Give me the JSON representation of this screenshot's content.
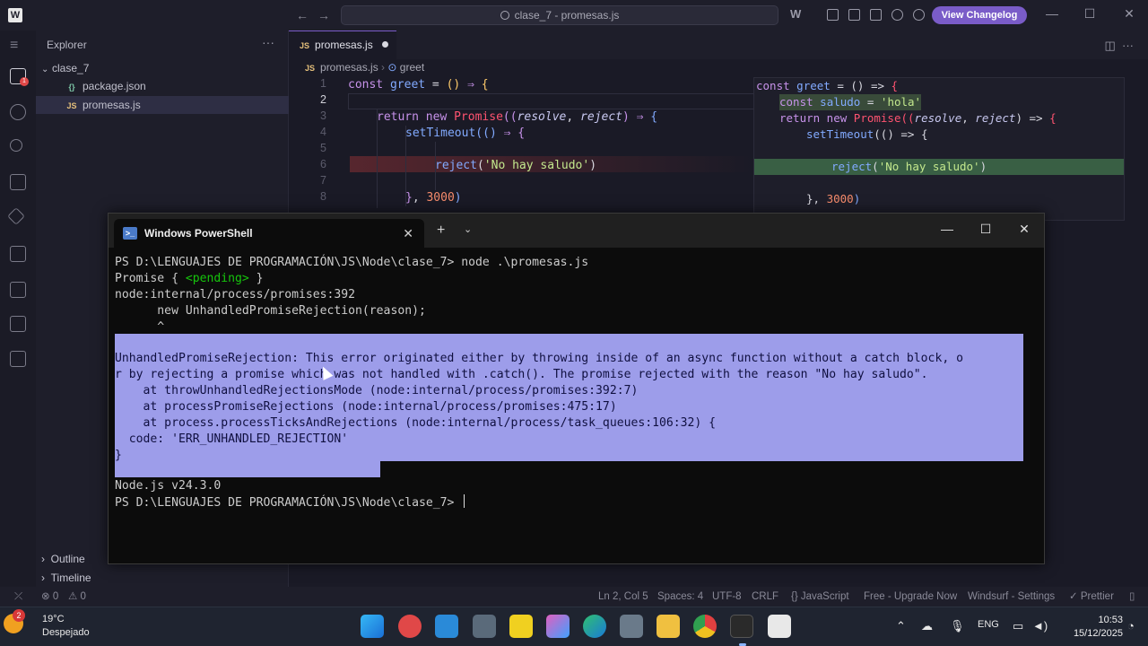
{
  "titlebar": {
    "search_text": "clase_7 - promesas.js",
    "changelog_label": "View Changelog",
    "minimize": "—",
    "maximize": "☐",
    "close": "✕",
    "back": "←",
    "forward": "→"
  },
  "sidebar": {
    "title": "Explorer",
    "more": "···",
    "folder": "clase_7",
    "files": [
      {
        "name": "package.json",
        "icon": "{}"
      },
      {
        "name": "promesas.js",
        "icon": "JS"
      }
    ],
    "outline": "Outline",
    "timeline": "Timeline",
    "badge": "1"
  },
  "editor": {
    "tab_label": "promesas.js",
    "tab_icon": "JS",
    "breadcrumb": [
      "promesas.js",
      "greet"
    ],
    "line_numbers": [
      "1",
      "2",
      "3",
      "4",
      "5",
      "6",
      "7",
      "8"
    ],
    "code": {
      "l1": [
        "const",
        " ",
        "greet",
        " = ",
        "()",
        " ⇒ ",
        "{"
      ],
      "l3": [
        "return",
        " ",
        "new",
        " ",
        "Promise",
        "((",
        "resolve",
        ", ",
        "reject",
        ")",
        " ⇒ ",
        "{"
      ],
      "l4": [
        "setTimeout",
        "((",
        ")",
        " ⇒ ",
        "{"
      ],
      "l6": [
        "reject",
        "(",
        "'No hay saludo'",
        ")"
      ],
      "l8": [
        "}",
        ", ",
        "3000",
        ")"
      ]
    }
  },
  "peek": {
    "l1": [
      "const",
      " greet ",
      "= () => ",
      "{"
    ],
    "l2": [
      "const",
      " saludo ",
      "= ",
      "'hola'"
    ],
    "l3": [
      "return",
      " new ",
      "Promise",
      "((",
      "resolve",
      ", ",
      "reject",
      ") => ",
      "{"
    ],
    "l4": [
      "setTimeout",
      "(() => {"
    ],
    "l6": [
      "reject",
      "(",
      "'No hay saludo'",
      ")"
    ],
    "l8": [
      "}, ",
      "3000",
      ")"
    ]
  },
  "powershell": {
    "tab_title": "Windows PowerShell",
    "tab_close": "✕",
    "new_tab": "+",
    "dropdown": "⌄",
    "minimize": "—",
    "maximize": "☐",
    "close": "✕",
    "lines": [
      "PS D:\\LENGUAJES DE PROGRAMACIÓN\\JS\\Node\\clase_7> node .\\promesas.js",
      "Promise { ",
      "<pending>",
      " }",
      "node:internal/process/promises:392",
      "      new UnhandledPromiseRejection(reason);",
      "      ^",
      "",
      "UnhandledPromiseRejection: This error originated either by throwing inside of an async function without a catch block, o",
      "r by rejecting a promise which was not handled with .catch(). The promise rejected with the reason \"No hay saludo\".",
      "    at throwUnhandledRejectionsMode (node:internal/process/promises:392:7)",
      "    at processPromiseRejections (node:internal/process/promises:475:17)",
      "    at process.processTicksAndRejections (node:internal/process/task_queues:106:32) {",
      "  code: 'ERR_UNHANDLED_REJECTION'",
      "}",
      "",
      "Node.js v24.3.0",
      "PS D:\\LENGUAJES DE PROGRAMACIÓN\\JS\\Node\\clase_7> "
    ]
  },
  "statusbar": {
    "errors": "⊗ 0",
    "warnings": "⚠ 0",
    "position": "Ln 2, Col 5",
    "spaces": "Spaces: 4",
    "encoding": "UTF-8",
    "eol": "CRLF",
    "language": "{} JavaScript",
    "upgrade": "Free - Upgrade Now",
    "settings": "Windsurf - Settings",
    "prettier": "✓ Prettier",
    "remote": "⤫"
  },
  "taskbar": {
    "temperature": "19°C",
    "weather": "Despejado",
    "weather_badge": "2",
    "language": "ENG",
    "time": "10:53",
    "date": "15/12/2025"
  }
}
